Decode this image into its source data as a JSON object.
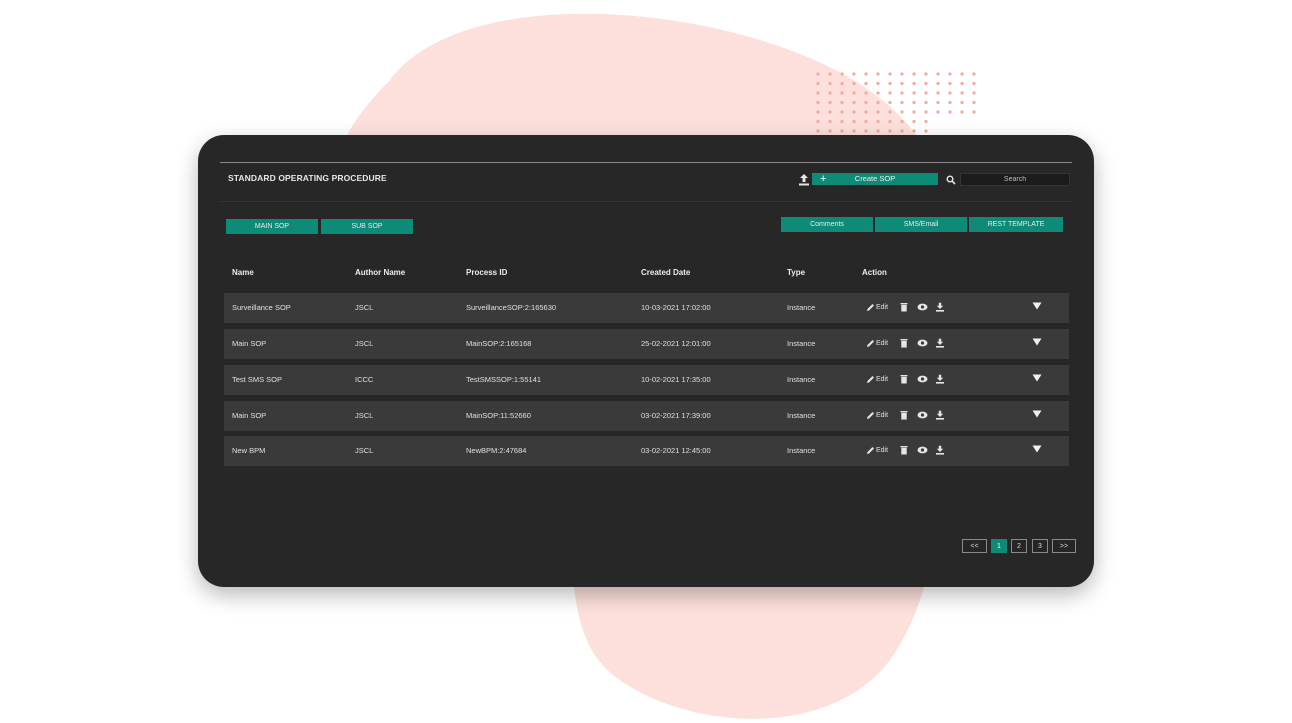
{
  "colors": {
    "accent": "#0e8b78",
    "panel": "#272727",
    "row": "#3a3a3a",
    "blob": "#fde0dc",
    "dots": "#f3a99c"
  },
  "header": {
    "title": "STANDARD OPERATING PROCEDURE",
    "create_label": "Create SOP",
    "search_placeholder": "Search"
  },
  "tabs_left": [
    "MAIN SOP",
    "SUB SOP"
  ],
  "tabs_right": [
    "Comments",
    "SMS/Email",
    "REST TEMPLATE"
  ],
  "table": {
    "columns": [
      "Name",
      "Author Name",
      "Process ID",
      "Created Date",
      "Type",
      "Action"
    ],
    "rows": [
      {
        "name": "Surveillance SOP",
        "author": "JSCL",
        "process_id": "SurveillanceSOP:2:165630",
        "created": "10-03-2021 17:02:00",
        "type": "Instance"
      },
      {
        "name": "Main SOP",
        "author": "JSCL",
        "process_id": "MainSOP:2:165168",
        "created": "25-02-2021 12:01:00",
        "type": "Instance"
      },
      {
        "name": "Test SMS SOP",
        "author": "ICCC",
        "process_id": "TestSMSSOP:1:55141",
        "created": "10-02-2021 17:35:00",
        "type": "Instance"
      },
      {
        "name": "Main SOP",
        "author": "JSCL",
        "process_id": "MainSOP:11:52660",
        "created": "03-02-2021 17:39:00",
        "type": "Instance"
      },
      {
        "name": "New BPM",
        "author": "JSCL",
        "process_id": "NewBPM:2:47684",
        "created": "03-02-2021 12:45:00",
        "type": "Instance"
      }
    ],
    "edit_label": "Edit",
    "action_icons": [
      "edit-icon",
      "trash-icon",
      "eye-icon",
      "download-icon",
      "caret-down-icon"
    ]
  },
  "pagination": {
    "prev": "<<",
    "pages": [
      "1",
      "2",
      "3"
    ],
    "current": "1",
    "next": ">>"
  }
}
